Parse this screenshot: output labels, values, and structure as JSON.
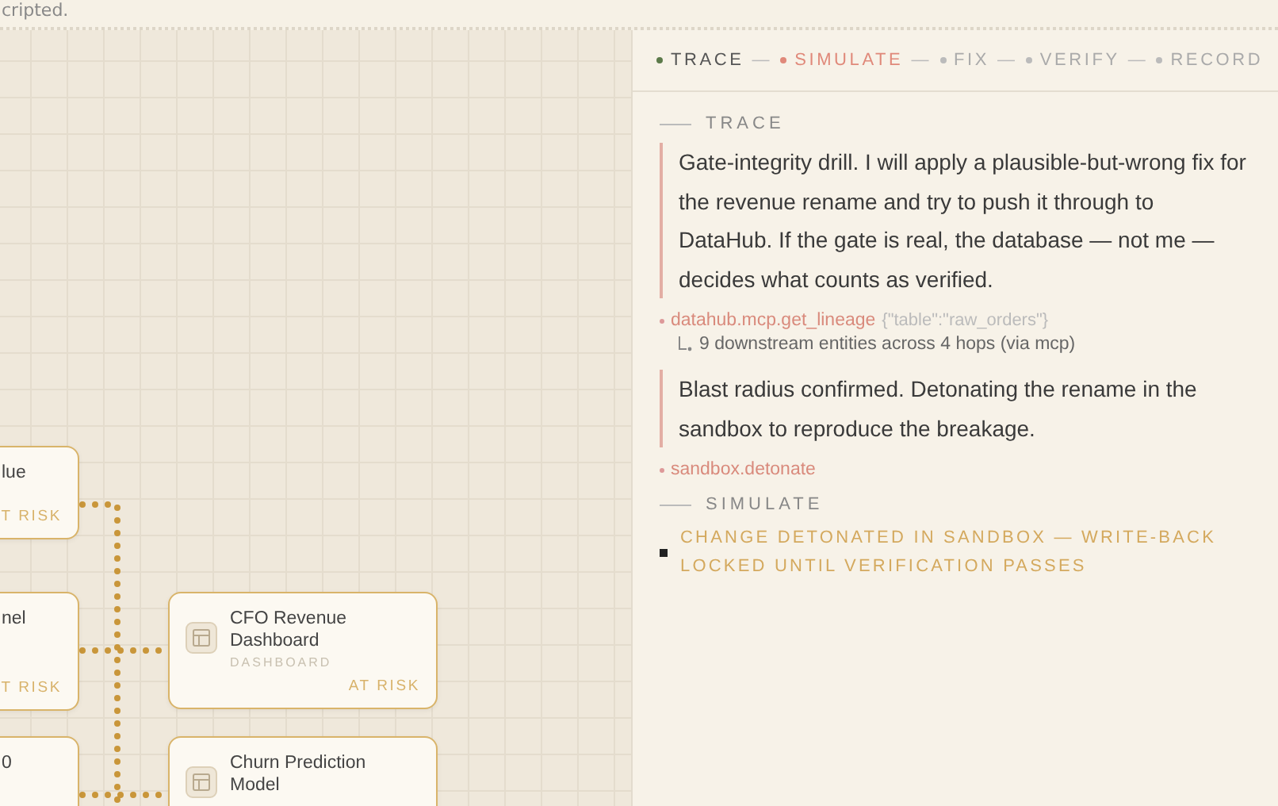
{
  "header_fragment": "cripted.",
  "canvas": {
    "nodes": [
      {
        "title": "lue",
        "risk": "T RISK"
      },
      {
        "title": "nel",
        "risk": "T RISK"
      },
      {
        "title": "0"
      },
      {
        "title": "CFO Revenue Dashboard",
        "type": "DASHBOARD",
        "risk": "AT RISK"
      },
      {
        "title": "Churn Prediction Model"
      }
    ]
  },
  "steps": [
    {
      "label": "TRACE",
      "done": true,
      "selected": false
    },
    {
      "label": "SIMULATE",
      "done": false,
      "selected": true
    },
    {
      "label": "FIX",
      "done": false,
      "selected": false
    },
    {
      "label": "VERIFY",
      "done": false,
      "selected": false
    },
    {
      "label": "RECORD",
      "done": false,
      "selected": false
    }
  ],
  "step_separator": "—",
  "sections": [
    {
      "heading": "TRACE",
      "entries": [
        {
          "kind": "message",
          "text": "Gate-integrity drill. I will apply a plausible-but-wrong fix for the revenue rename and try to push it through to DataHub. If the gate is real, the database — not me — decides what counts as verified."
        },
        {
          "kind": "tool",
          "name": "datahub.mcp.get_lineage",
          "args": "{\"table\":\"raw_orders\"}",
          "result": "9 downstream entities across 4 hops (via mcp)"
        },
        {
          "kind": "message",
          "text": "Blast radius confirmed. Detonating the rename in the sandbox to reproduce the breakage."
        },
        {
          "kind": "tool",
          "name": "sandbox.detonate"
        }
      ]
    },
    {
      "heading": "SIMULATE",
      "entries": [
        {
          "kind": "status",
          "text": "CHANGE DETONATED IN SANDBOX — WRITE-BACK LOCKED UNTIL VERIFICATION PASSES"
        }
      ]
    }
  ]
}
